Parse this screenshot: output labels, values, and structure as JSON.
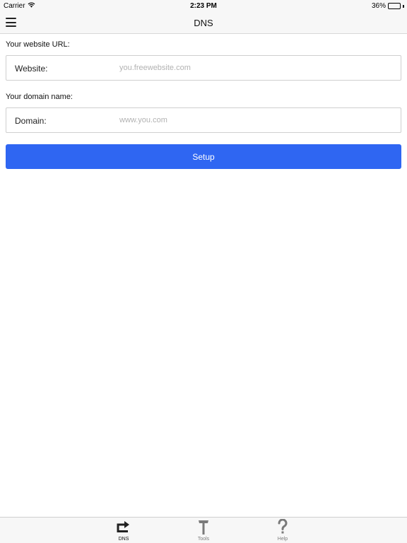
{
  "status_bar": {
    "carrier": "Carrier",
    "time": "2:23 PM",
    "battery_text": "36%",
    "battery_level": 0.36
  },
  "nav": {
    "title": "DNS"
  },
  "form": {
    "website": {
      "caption": "Your website URL:",
      "label": "Website:",
      "value": "",
      "placeholder": "you.freewebsite.com"
    },
    "domain": {
      "caption": "Your domain name:",
      "label": "Domain:",
      "value": "",
      "placeholder": "www.you.com"
    },
    "setup_label": "Setup"
  },
  "tabs": [
    {
      "label": "DNS",
      "icon": "redirect-arrow-icon",
      "active": true
    },
    {
      "label": "Tools",
      "icon": "hammer-icon",
      "active": false
    },
    {
      "label": "Help",
      "icon": "question-mark-icon",
      "active": false
    }
  ],
  "colors": {
    "accent": "#2f66f2",
    "bar_background": "#f7f7f7",
    "active_tab_icon": "#222222",
    "inactive_tab_icon": "#7a7a7a"
  }
}
